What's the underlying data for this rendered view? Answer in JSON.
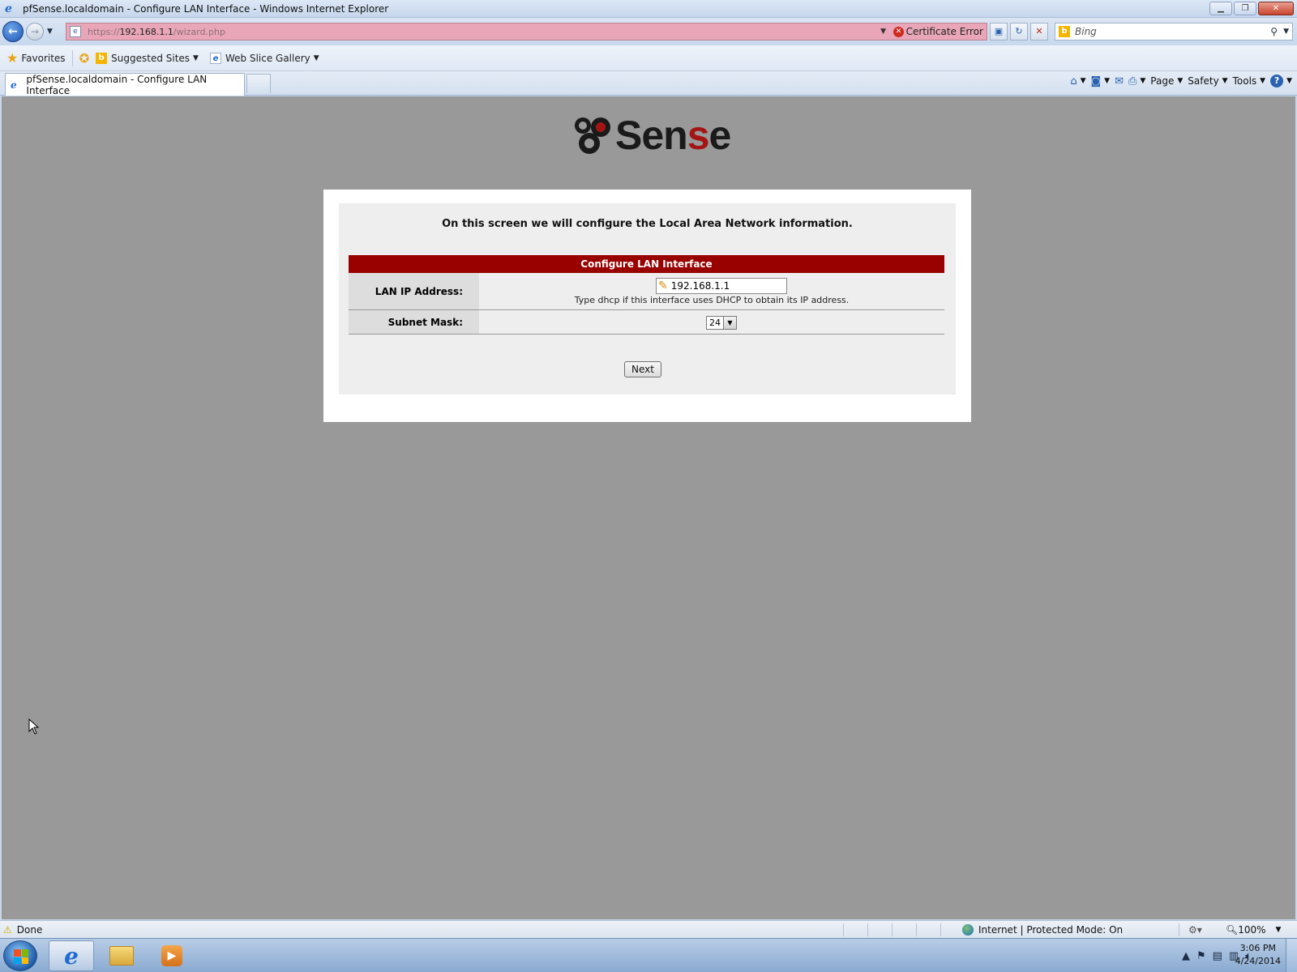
{
  "window": {
    "title": "pfSense.localdomain - Configure LAN Interface - Windows Internet Explorer",
    "controls": [
      "▁",
      "❐",
      "✕"
    ]
  },
  "navbar": {
    "url_scheme": "https://",
    "url_host": "192.168.1.1",
    "url_path": "/wizard.php",
    "cert_error_label": "Certificate Error",
    "search_placeholder": "Bing"
  },
  "favorites": {
    "label": "Favorites",
    "items": [
      {
        "label": "Suggested Sites",
        "icon": "bing-icon"
      },
      {
        "label": "Web Slice Gallery",
        "icon": "ie-icon"
      }
    ]
  },
  "tabs": [
    {
      "label": "pfSense.localdomain - Configure LAN Interface",
      "active": true
    }
  ],
  "command_bar": {
    "page": "Page",
    "safety": "Safety",
    "tools": "Tools"
  },
  "page": {
    "logo_text_pre": "Sen",
    "logo_text_red": "s",
    "logo_text_post": "e",
    "intro": "On this screen we will configure the Local Area Network information.",
    "section_title": "Configure LAN Interface",
    "lan_ip": {
      "label": "LAN IP Address:",
      "value": "192.168.1.1",
      "hint": "Type dhcp if this interface uses DHCP to obtain its IP address."
    },
    "subnet_mask": {
      "label": "Subnet Mask:",
      "value": "24"
    },
    "next_label": "Next"
  },
  "statusbar": {
    "status": "Done",
    "zone": "Internet | Protected Mode: On",
    "zoom": "100%"
  },
  "taskbar": {
    "time": "3:06 PM",
    "date": "4/24/2014"
  },
  "colors": {
    "page_background": "#999999",
    "header_red": "#990000",
    "logo_red": "#a31515"
  }
}
